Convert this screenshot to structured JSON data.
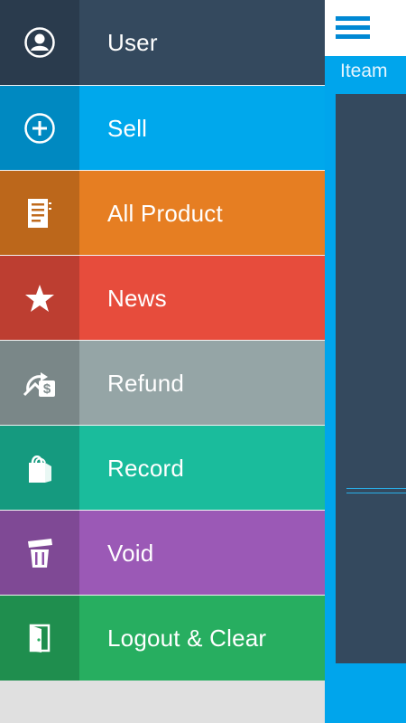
{
  "menu": {
    "items": [
      {
        "label": "User",
        "icon": "user-icon",
        "color": "#34495e"
      },
      {
        "label": "Sell",
        "icon": "plus-circle-icon",
        "color": "#00a8ec"
      },
      {
        "label": "All Product",
        "icon": "document-list-icon",
        "color": "#e67e22"
      },
      {
        "label": "News",
        "icon": "star-icon",
        "color": "#e74c3c"
      },
      {
        "label": "Refund",
        "icon": "refund-money-icon",
        "color": "#95a5a6"
      },
      {
        "label": "Record",
        "icon": "shopping-bag-icon",
        "color": "#1abc9c"
      },
      {
        "label": "Void",
        "icon": "trash-icon",
        "color": "#9b59b6"
      },
      {
        "label": "Logout & Clear",
        "icon": "exit-door-icon",
        "color": "#27ae60"
      }
    ]
  },
  "panel": {
    "tab_label": "Iteam",
    "menu_icon": "hamburger-menu-icon"
  }
}
